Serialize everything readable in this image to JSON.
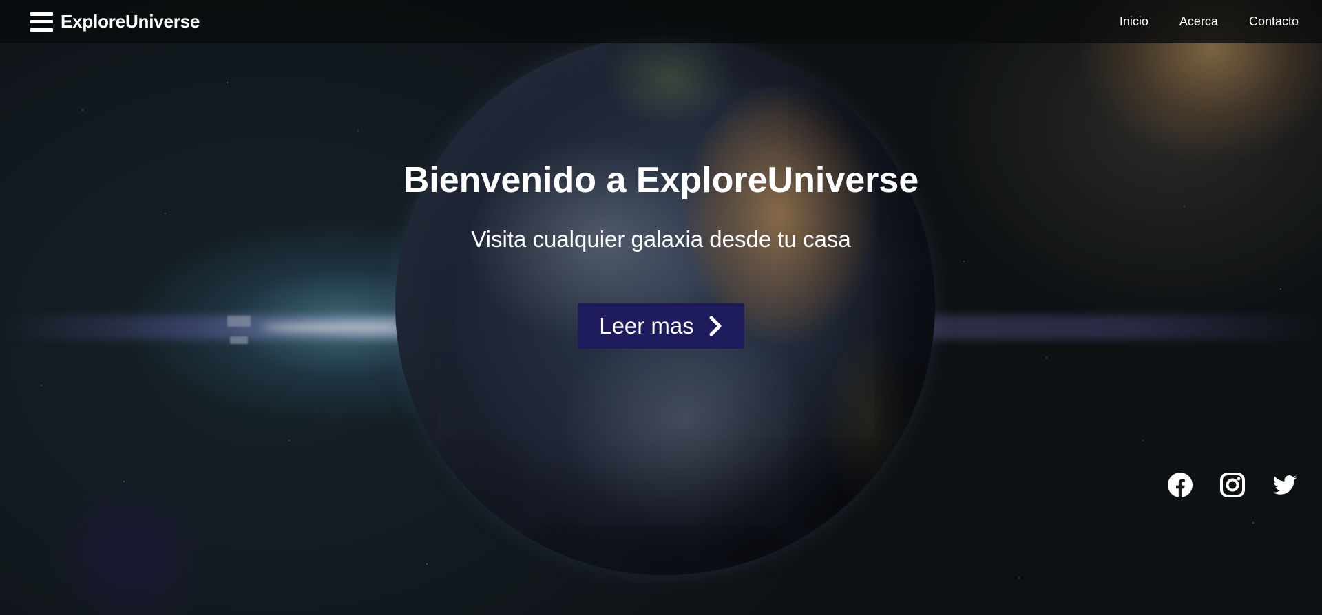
{
  "app": {
    "brand": "ExploreUniverse"
  },
  "nav": {
    "menu_icon": "hamburger-menu-icon",
    "links": [
      "Inicio",
      "Acerca",
      "Contacto"
    ]
  },
  "hero": {
    "title": "Bienvenido a ExploreUniverse",
    "subtitle": "Visita cualquier galaxia desde tu casa",
    "cta_label": "Leer mas",
    "cta_icon": "chevron-right-icon",
    "cta_color": "#1d1b5c"
  },
  "social": {
    "icons": [
      "facebook-icon",
      "instagram-icon",
      "twitter-icon"
    ]
  }
}
